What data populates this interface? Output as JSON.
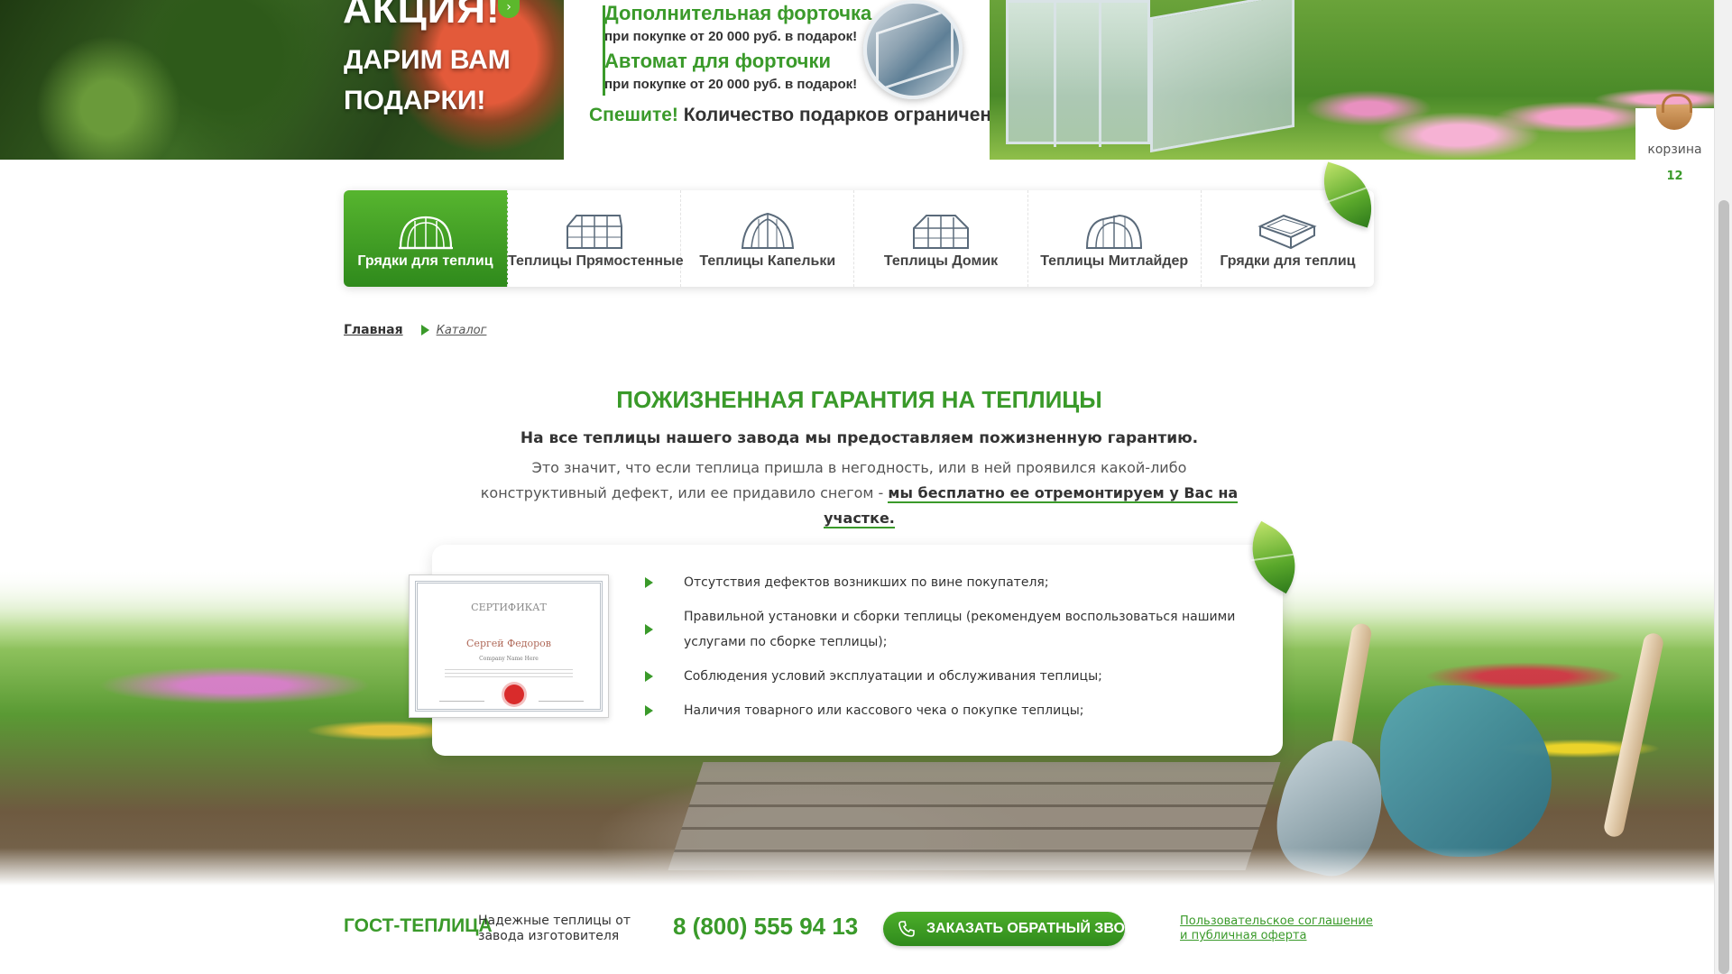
{
  "promo": {
    "title": "АКЦИЯ!",
    "subtitle_line1": "ДАРИМ ВАМ",
    "subtitle_line2": "ПОДАРКИ!",
    "gifts": [
      {
        "title": "Дополнительная форточка",
        "note": "при покупке от 20 000 руб. в подарок!"
      },
      {
        "title": "Автомат для форточки",
        "note": "при покупке от 20 000 руб. в подарок!"
      }
    ],
    "hurry_label": "Спешите!",
    "hurry_text": " Количество подарков ограничено!"
  },
  "cart": {
    "label": "корзина",
    "count": "12"
  },
  "categories": [
    {
      "label": "Грядки для теплиц",
      "icon": "greenhouse-arch-icon",
      "active": true
    },
    {
      "label": "Теплицы Прямостенные",
      "icon": "greenhouse-straight-icon",
      "active": false
    },
    {
      "label": "Теплицы Капельки",
      "icon": "greenhouse-drop-icon",
      "active": false
    },
    {
      "label": "Теплицы Домик",
      "icon": "greenhouse-house-icon",
      "active": false
    },
    {
      "label": "Теплицы Митлайдер",
      "icon": "greenhouse-mitlider-icon",
      "active": false
    },
    {
      "label": "Грядки для теплиц",
      "icon": "garden-bed-icon",
      "active": false
    }
  ],
  "breadcrumb": {
    "home": "Главная",
    "current": "Каталог"
  },
  "guarantee": {
    "title": "ПОЖИЗНЕННАЯ ГАРАНТИЯ НА ТЕПЛИЦЫ",
    "lead": "На все теплицы нашего завода мы предоставляем пожизненную гарантию.",
    "text": "Это значит, что если теплица пришла в негодность, или в ней проявился какой-либо конструктивный дефект, или ее придавило снегом - ",
    "highlight": "мы бесплатно ее отремонтируем у Вас на участке."
  },
  "certificate": {
    "title": "СЕРТИФИКАТ",
    "name": "Сергей Федоров",
    "company": "Company Name Here"
  },
  "conditions": [
    "Отсутствия дефектов возникших по вине покупателя;",
    "Правильной установки и сборки теплицы (рекомендуем воспользоваться нашими услугами по сборке теплицы);",
    "Соблюдения условий эксплуатации и обслуживания теплицы;",
    "Наличия товарного или кассового чека о покупке теплицы;"
  ],
  "footer": {
    "brand": "ГОСТ-ТЕПЛИЦА",
    "tagline": "Надежные теплицы от завода изготовителя",
    "phone": "8 (800) 555 94 13",
    "callback_label": "ЗАКАЗАТЬ ОБРАТНЫЙ ЗВОНОК",
    "link1": "Пользовательское соглашение",
    "link2": "и публичная оферта"
  },
  "colors": {
    "accent": "#3a9a2a",
    "accent_dark": "#2f8a1c",
    "text": "#333333"
  }
}
